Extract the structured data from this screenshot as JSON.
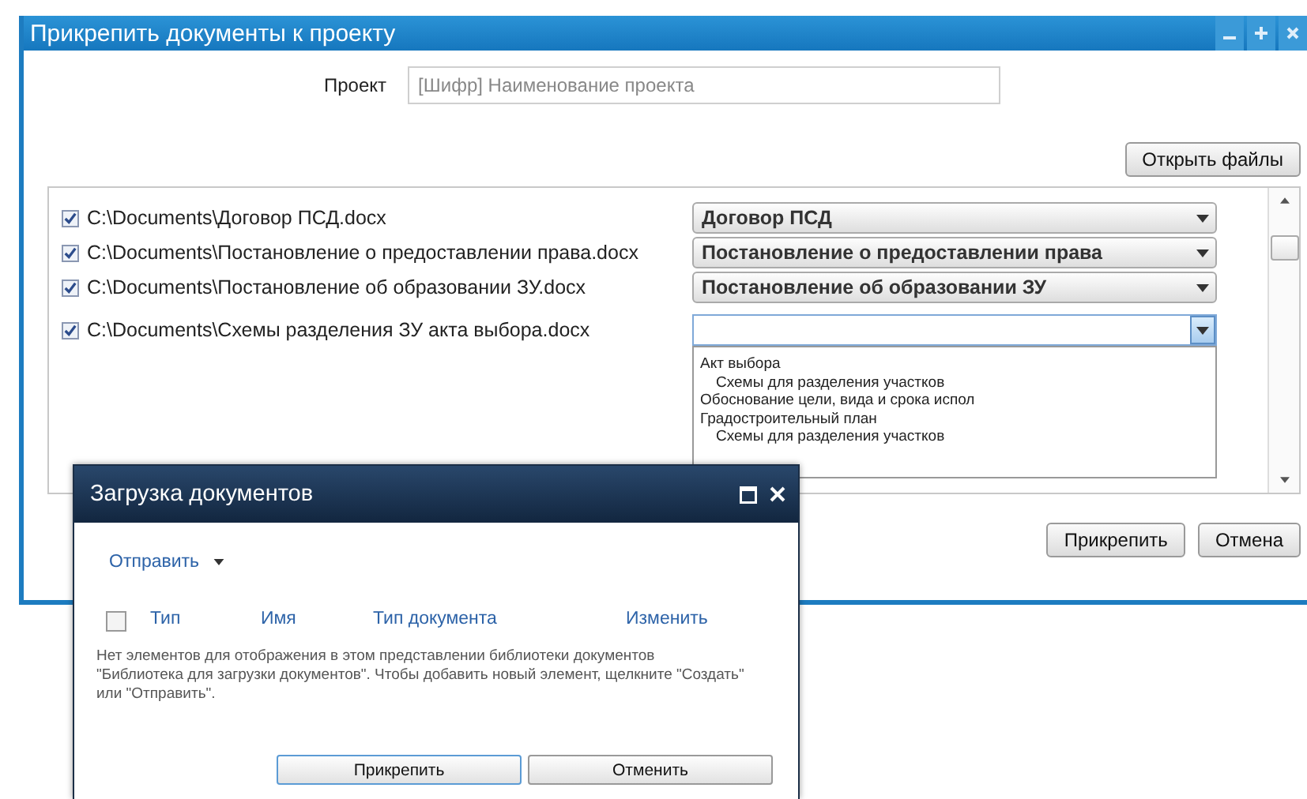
{
  "window": {
    "title": "Прикрепить документы к проекту"
  },
  "project": {
    "label": "Проект",
    "placeholder": "[Шифр] Наименование проекта"
  },
  "open_files_button": "Открыть файлы",
  "files": [
    {
      "path": "C:\\Documents\\Договор ПСД.docx",
      "checked": true,
      "document_type": "Договор ПСД",
      "expanded": false
    },
    {
      "path": "C:\\Documents\\Постановление о предоставлении права.docx",
      "checked": true,
      "document_type": "Постановление о предоставлении права",
      "expanded": false
    },
    {
      "path": "C:\\Documents\\Постановление об образовании ЗУ.docx",
      "checked": true,
      "document_type": "Постановление об образовании ЗУ",
      "expanded": false
    },
    {
      "path": "C:\\Documents\\Схемы разделения ЗУ акта выбора.docx",
      "checked": true,
      "expanded": true
    }
  ],
  "document_type_options": [
    {
      "label": "Акт выбора",
      "children": [
        {
          "label": "Схемы для разделения участков"
        }
      ]
    },
    {
      "label": "Обоснование цели, вида и срока испол"
    },
    {
      "label": "Градостроительный план",
      "children": [
        {
          "label": "Схемы для разделения участков"
        }
      ]
    }
  ],
  "buttons": [
    "Прикрепить",
    "Отмена"
  ],
  "upload_dialog": {
    "title": "Загрузка документов",
    "send_menu": "Отправить",
    "select_all_checked": false,
    "columns": [
      "Тип",
      "Имя",
      "Тип документа",
      "Изменить"
    ],
    "empty_message": "Нет элементов для отображения в этом представлении библиотеки документов \"Библиотека для загрузки документов\". Чтобы добавить новый элемент, щелкните \"Создать\" или \"Отправить\".",
    "buttons": [
      "Прикрепить",
      "Отменить"
    ]
  }
}
